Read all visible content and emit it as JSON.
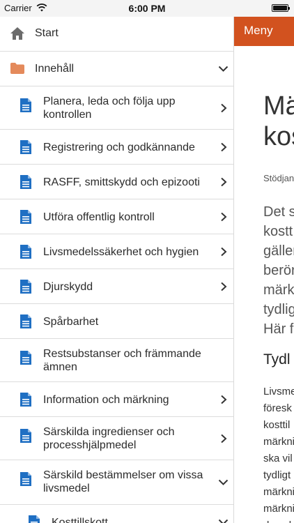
{
  "status_bar": {
    "carrier": "Carrier",
    "time": "6:00 PM"
  },
  "drawer": {
    "start": "Start",
    "section": "Innehåll",
    "items": [
      {
        "line1": "Planera, leda och följa upp",
        "line2": "kontrollen"
      },
      {
        "line1": "Registrering och godkännande",
        "line2": ""
      },
      {
        "line1": "RASFF, smittskydd och epizooti",
        "line2": ""
      },
      {
        "line1": "Utföra offentlig kontroll",
        "line2": ""
      },
      {
        "line1": "Livsmedelssäkerhet och hygien",
        "line2": ""
      },
      {
        "line1": "Djurskydd",
        "line2": ""
      },
      {
        "line1": "Spårbarhet",
        "line2": ""
      },
      {
        "line1": "Restsubstanser och främmande",
        "line2": "ämnen"
      },
      {
        "line1": "Information och märkning",
        "line2": ""
      },
      {
        "line1": "Särskilda ingredienser och",
        "line2": "processhjälpmedel"
      },
      {
        "line1": "Särskild bestämmelser om vissa",
        "line2": "livsmedel"
      }
    ],
    "subitem": "Kosttillskott"
  },
  "content": {
    "menu_label": "Meny",
    "heading_line1": "Mä",
    "heading_line2": "kos",
    "byline": "Stödjan",
    "lead_lines": [
      "Det st",
      "kostt",
      "gäller",
      "berörd",
      "märkn",
      "tydlig",
      "Här fa"
    ],
    "subheading": "Tydl",
    "para_lines": [
      "Livsme",
      "föresk",
      "kosttil",
      "märkni",
      "ska vil",
      "tydligt",
      "märkni",
      "märkni",
      "den sk"
    ]
  },
  "colors": {
    "accent": "#d2521f",
    "doc_icon": "#1f6fc3",
    "folder_icon": "#e48a5b",
    "home_icon": "#6b6b6b"
  }
}
